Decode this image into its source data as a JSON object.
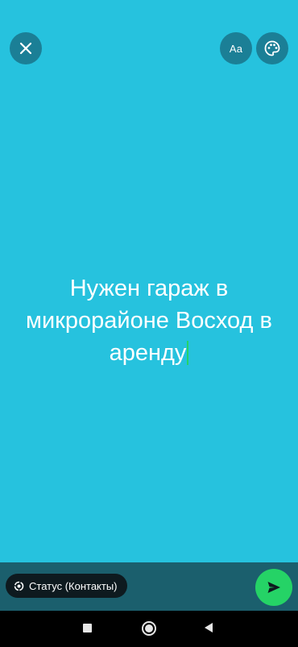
{
  "editor": {
    "background_color": "#26c2de",
    "status_text": "Нужен гараж в микрорайоне Восход в аренду",
    "caret_color": "#25d366"
  },
  "toolbar": {
    "close_icon": "close-icon",
    "font_label": "Aa",
    "palette_icon": "palette-icon",
    "button_color": "#1b7f96"
  },
  "footer": {
    "privacy_label": "Статус (Контакты)",
    "privacy_icon": "status-ring-icon",
    "send_icon": "send-icon",
    "send_color": "#25d366"
  },
  "navigation": {
    "items": [
      "recents-icon",
      "home-icon",
      "back-icon"
    ]
  }
}
